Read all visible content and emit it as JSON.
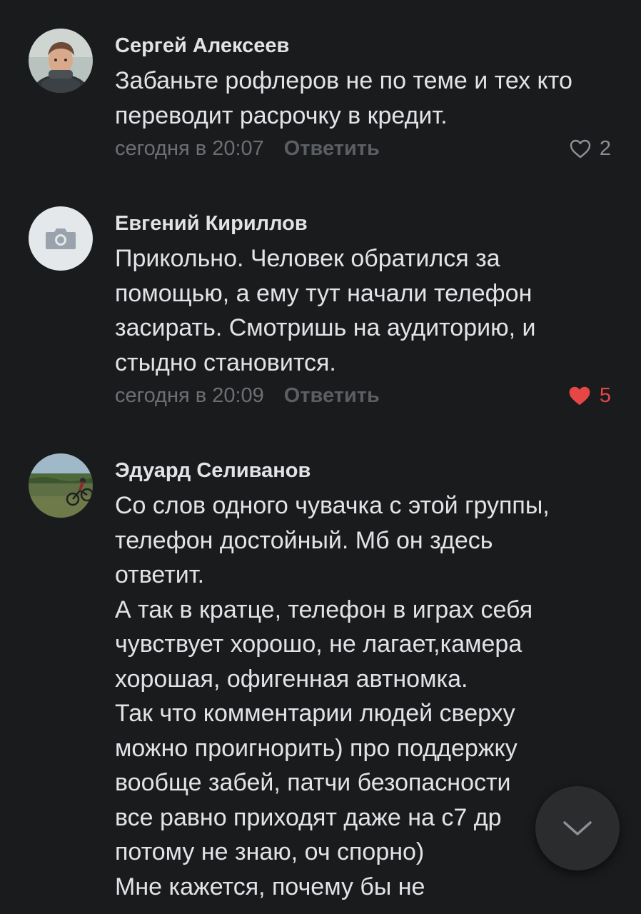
{
  "comments": [
    {
      "author": "Сергей Алексеев",
      "lines": [
        "Забаньте рофлеров не по теме и тех кто",
        "переводит расрочку в кредит."
      ],
      "time": "сегодня в 20:07",
      "reply": "Ответить",
      "likes": "2",
      "liked": false
    },
    {
      "author": "Евгений Кириллов",
      "lines": [
        "Прикольно. Человек обратился за",
        "помощью, а ему тут начали телефон",
        "засирать. Смотришь на аудиторию, и",
        "стыдно становится."
      ],
      "time": "сегодня в 20:09",
      "reply": "Ответить",
      "likes": "5",
      "liked": true
    },
    {
      "author": "Эдуард Селиванов",
      "lines": [
        "Со слов одного чувачка с этой группы,",
        "телефон достойный. Мб он здесь",
        "ответит.",
        "А так в кратце, телефон в играх себя",
        "чувствует  хорошо, не лагает,камера",
        "хорошая, офигенная автномка.",
        "Так что комментарии людей сверху",
        "можно проигнорить) про поддержку",
        "вообще  забей, патчи безопасности",
        "все равно приходят даже на с7 др",
        "потому не знаю, оч спорно)",
        "Мне кажется,  почему бы  не"
      ]
    }
  ],
  "colors": {
    "background": "#1a1b1d",
    "like_active": "#e64646"
  }
}
